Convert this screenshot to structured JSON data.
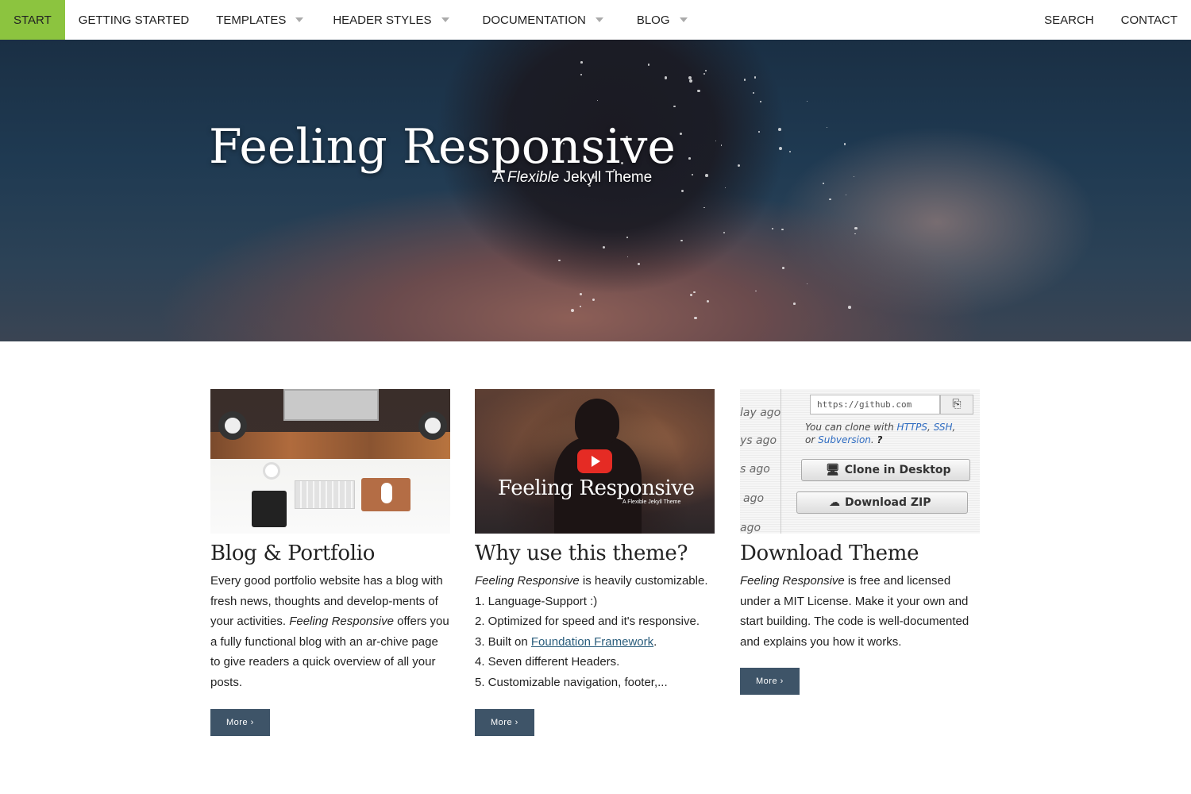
{
  "nav": {
    "items": [
      {
        "label": "START",
        "active": true,
        "dropdown": false
      },
      {
        "label": "GETTING STARTED",
        "active": false,
        "dropdown": false
      },
      {
        "label": "TEMPLATES",
        "active": false,
        "dropdown": true
      },
      {
        "label": "HEADER STYLES",
        "active": false,
        "dropdown": true
      },
      {
        "label": "DOCUMENTATION",
        "active": false,
        "dropdown": true
      },
      {
        "label": "BLOG",
        "active": false,
        "dropdown": true
      }
    ],
    "right": [
      "SEARCH",
      "CONTACT"
    ],
    "accent_color": "#8cc43f"
  },
  "hero": {
    "title": "Feeling Responsive",
    "subtitle_prefix": "A ",
    "subtitle_em": "Flexible",
    "subtitle_suffix": " Jekyll Theme"
  },
  "cards": [
    {
      "title": "Blog & Portfolio",
      "text_parts": [
        "Every good portfolio website has a blog with fresh news, thoughts and develop-ments of your activities. ",
        "Feeling Responsive",
        " offers you a fully functional blog with an ar-chive page to give readers a quick overview of all your posts."
      ],
      "button": "More ›"
    },
    {
      "title": "Why use this theme?",
      "intro_em": "Feeling Responsive",
      "intro_rest": " is heavily customizable.",
      "list": [
        "1. Language-Support :)",
        "2. Optimized for speed and it's responsive.",
        "3. Built on ",
        "4. Seven different Headers.",
        "5. Customizable navigation, footer,..."
      ],
      "link_text": "Foundation Framework",
      "link_after": ".",
      "video_title": "Feeling Responsive",
      "video_sub": "A Flexible Jekyll Theme",
      "button": "More ›"
    },
    {
      "title": "Download Theme",
      "text_em": "Feeling Responsive",
      "text_rest": " is free and licensed under a MIT License. Make it your own and start building. The code is well-documented and explains you how it works.",
      "button": "More ›",
      "gh": {
        "ago_labels": [
          "lay ago",
          "ys ago",
          "s ago",
          "ago",
          "ago"
        ],
        "url": "https://github.com",
        "clone_line1": "You can clone with ",
        "https": "HTTPS",
        "ssh": "SSH",
        "or": "or ",
        "svn": "Subversion",
        "clone_desktop": "Clone in Desktop",
        "download_zip": "Download ZIP"
      }
    }
  ],
  "button_color": "#3e5468"
}
